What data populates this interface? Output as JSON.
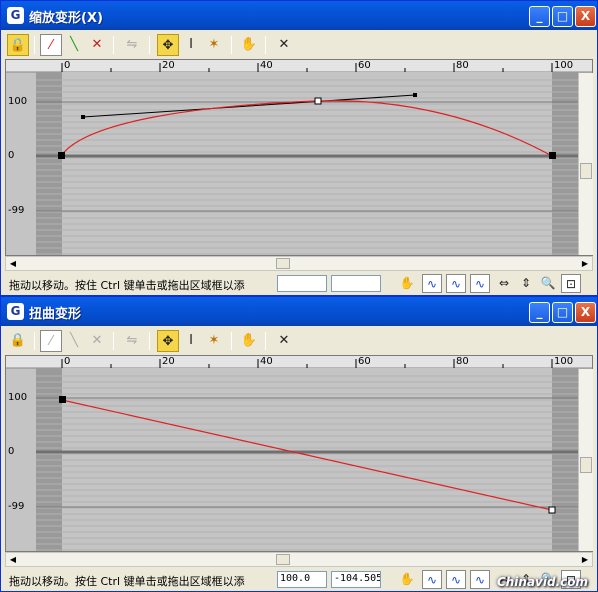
{
  "watermark": "Chinavid.com",
  "panels": [
    {
      "title": "缩放变形(X)",
      "title_icon": "3ds-max-logo-icon",
      "window_buttons": {
        "minimize": "_",
        "maximize": "□",
        "close": "X"
      },
      "ruler_labels": [
        "0",
        "20",
        "40",
        "60",
        "80",
        "100"
      ],
      "y_labels": [
        "100",
        "0",
        "-99"
      ],
      "status_text": "拖动以移动。按住 Ctrl 键单击或拖出区域框以添",
      "field_frame": "",
      "field_value": "",
      "curve_color": "#e02020"
    },
    {
      "title": "扭曲变形",
      "title_icon": "3ds-max-logo-icon",
      "window_buttons": {
        "minimize": "_",
        "maximize": "□",
        "close": "X"
      },
      "ruler_labels": [
        "0",
        "20",
        "40",
        "60",
        "80",
        "100"
      ],
      "y_labels": [
        "100",
        "0",
        "-99"
      ],
      "status_text": "拖动以移动。按住 Ctrl 键单击或拖出区域框以添",
      "field_frame": "100.0",
      "field_value": "-104.505",
      "curve_color": "#e02020"
    }
  ]
}
